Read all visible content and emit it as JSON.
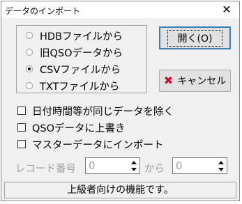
{
  "window": {
    "title": "データのインポート",
    "close_label": "✕"
  },
  "format_options": [
    {
      "label": "HDBファイルから",
      "checked": false
    },
    {
      "label": "旧QSOデータから",
      "checked": false
    },
    {
      "label": "CSVファイルから",
      "checked": true
    },
    {
      "label": "TXTファイルから",
      "checked": false
    }
  ],
  "buttons": {
    "open_label": "開く(O)",
    "cancel_label": "キャンセル"
  },
  "options": [
    {
      "label": "日付時間等が同じデータを除く",
      "checked": false
    },
    {
      "label": "QSOデータに上書き",
      "checked": false
    },
    {
      "label": "マスターデータにインポート",
      "checked": false
    }
  ],
  "range": {
    "label": "レコード番号",
    "from_value": "0",
    "separator": "から",
    "to_value": "0"
  },
  "status_text": "上級者向けの機能です。"
}
